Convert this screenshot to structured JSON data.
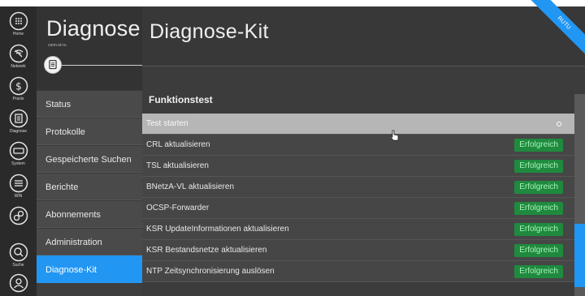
{
  "rail": {
    "items": [
      {
        "label": "Home",
        "icon": "grid-icon"
      },
      {
        "label": "Network",
        "icon": "network-icon"
      },
      {
        "label": "Praxis",
        "icon": "dollar-icon"
      },
      {
        "label": "Diagnose",
        "icon": "clipboard-icon"
      },
      {
        "label": "System",
        "icon": "minus-circle-icon"
      },
      {
        "label": "WIN",
        "icon": "equalizer-icon"
      },
      {
        "label": "",
        "icon": "link-icon"
      },
      {
        "label": "Suche",
        "icon": "search-icon"
      },
      {
        "label": "",
        "icon": "user-icon"
      }
    ]
  },
  "sidebar": {
    "title": "Diagnose",
    "subtitle": "conn-st-ru",
    "items": [
      {
        "label": "Status"
      },
      {
        "label": "Protokolle"
      },
      {
        "label": "Gespeicherte Suchen"
      },
      {
        "label": "Berichte"
      },
      {
        "label": "Abonnements"
      },
      {
        "label": "Administration"
      },
      {
        "label": "Diagnose-Kit"
      }
    ]
  },
  "main": {
    "title": "Diagnose-Kit",
    "ribbon": "RUTU",
    "section_title": "Funktionstest",
    "start_label": "Test starten",
    "tests": [
      {
        "label": "CRL aktualisieren",
        "status": "Erfolgreich"
      },
      {
        "label": "TSL aktualisieren",
        "status": "Erfolgreich"
      },
      {
        "label": "BNetzA-VL aktualisieren",
        "status": "Erfolgreich"
      },
      {
        "label": "OCSP-Forwarder",
        "status": "Erfolgreich"
      },
      {
        "label": "KSR UpdateInformationen aktualisieren",
        "status": "Erfolgreich"
      },
      {
        "label": "KSR Bestandsnetze aktualisieren",
        "status": "Erfolgreich"
      },
      {
        "label": "NTP Zeitsynchronisierung auslösen",
        "status": "Erfolgreich"
      }
    ]
  },
  "colors": {
    "accent": "#2196f3",
    "success": "#1f8a3e"
  }
}
